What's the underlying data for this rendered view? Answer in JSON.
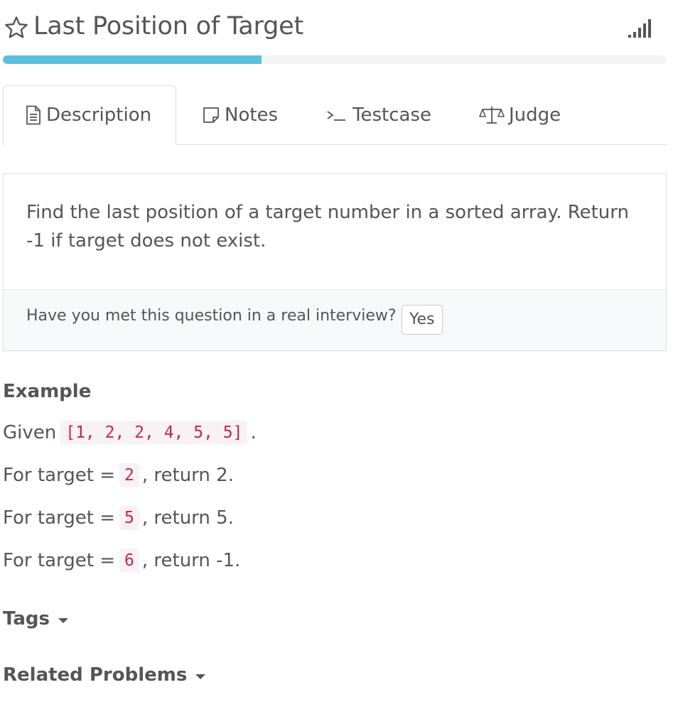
{
  "header": {
    "title": "Last Position of Target",
    "star_icon": "star-outline-icon",
    "difficulty_icon": "signal-bars-icon"
  },
  "progress": {
    "fraction": 0.39,
    "color": "#5bc0de"
  },
  "tabs": [
    {
      "label": "Description",
      "icon": "document-icon",
      "active": true
    },
    {
      "label": "Notes",
      "icon": "note-icon",
      "active": false
    },
    {
      "label": "Testcase",
      "icon": "terminal-icon",
      "active": false
    },
    {
      "label": "Judge",
      "icon": "scale-icon",
      "active": false
    }
  ],
  "description": {
    "text": "Find the last position of a target number in a sorted array. Return -1 if target does not exist.",
    "interview_question": "Have you met this question in a real interview?",
    "yes_label": "Yes"
  },
  "example": {
    "heading": "Example",
    "given_prefix": "Given",
    "given_array": "[1, 2, 2, 4, 5, 5]",
    "given_suffix": ".",
    "lines": [
      {
        "prefix": "For target =",
        "target": "2",
        "result": ", return 2."
      },
      {
        "prefix": "For target =",
        "target": "5",
        "result": ", return 5."
      },
      {
        "prefix": "For target =",
        "target": "6",
        "result": ", return -1."
      }
    ]
  },
  "sections": {
    "tags_label": "Tags",
    "related_label": "Related Problems"
  },
  "colors": {
    "text": "#555555",
    "code_text": "#c7254e",
    "code_bg": "#f9f2f4",
    "accent": "#5bc0de"
  }
}
